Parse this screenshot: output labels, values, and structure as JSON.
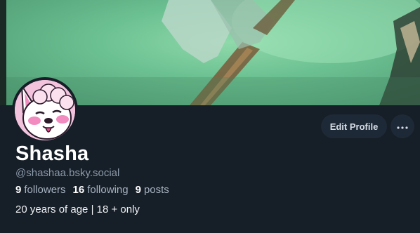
{
  "profile": {
    "display_name": "Shasha",
    "handle": "@shashaa.bsky.social",
    "bio": "20 years of age | 18 + only"
  },
  "stats": {
    "followers_count": "9",
    "followers_label": "followers",
    "following_count": "16",
    "following_label": "following",
    "posts_count": "9",
    "posts_label": "posts"
  },
  "actions": {
    "edit_profile_label": "Edit Profile",
    "more_glyph": "⋯"
  },
  "icons": {
    "more": "more-options-icon"
  },
  "colors": {
    "page_bg": "#161e27",
    "button_bg": "#1e2937",
    "banner_green": "#6cc192"
  }
}
